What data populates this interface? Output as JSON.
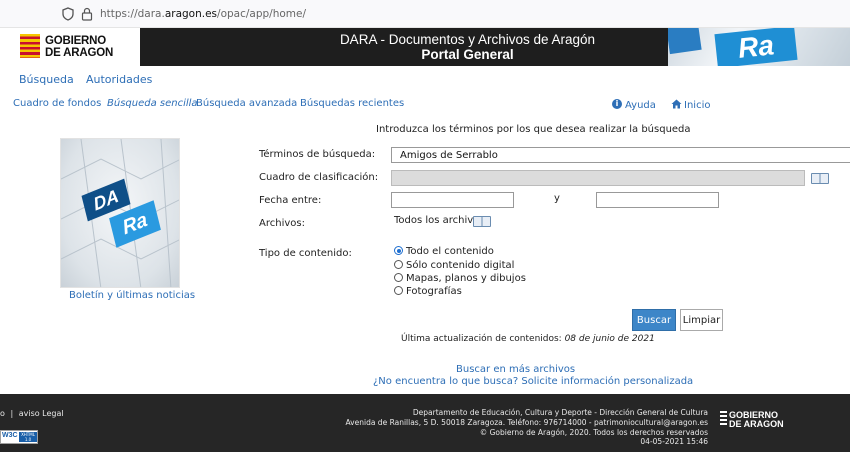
{
  "browser": {
    "url_prefix": "https://dara.",
    "url_domain": "aragon.es",
    "url_path": "/opac/app/home/"
  },
  "banner": {
    "logo_line1": "GOBIERNO",
    "logo_line2": "DE ARAGON",
    "title": "DARA - Documentos y Archivos de Aragón",
    "subtitle": "Portal General",
    "puzzle_text_1": "DA",
    "puzzle_text_2": "Ra"
  },
  "nav": {
    "busqueda": "Búsqueda",
    "autoridades": "Autoridades"
  },
  "subnav": {
    "cuadro": "Cuadro de fondos",
    "sencilla": "Búsqueda sencilla",
    "avanzada": "Búsqueda avanzada",
    "recientes": "Búsquedas recientes",
    "ayuda": "Ayuda",
    "inicio": "Inicio"
  },
  "sidebar": {
    "image_text_1": "DA",
    "image_text_2": "Ra",
    "news_link": "Boletín y últimas noticias"
  },
  "form": {
    "intro": "Introduzca los términos por los que desea realizar la búsqueda",
    "terms_label": "Términos de búsqueda:",
    "terms_value": "Amigos de Serrablo",
    "cuadro_label": "Cuadro de clasificación:",
    "fecha_label": "Fecha entre:",
    "fecha_and": "y",
    "archivos_label": "Archivos:",
    "archivos_value": "Todos los archivos",
    "tipo_label": "Tipo de contenido:",
    "options": [
      "Todo el contenido",
      "Sólo contenido digital",
      "Mapas, planos y dibujos",
      "Fotografías"
    ],
    "buscar": "Buscar",
    "limpiar": "Limpiar",
    "update_prefix": "Última actualización de contenidos: ",
    "update_date": "08 de junio de 2021"
  },
  "links": {
    "mas_archivos": "Buscar en más archivos",
    "solicite": "¿No encuentra lo que busca? Solicite información personalizada"
  },
  "footer": {
    "left_prefix": "o",
    "sep": "|",
    "aviso": "aviso Legal",
    "line1": "Departamento de Educación, Cultura y Deporte - Dirección General de Cultura",
    "line2": "Avenida de Ranillas, 5 D. 50018 Zaragoza. Teléfono: 976714000 - patrimoniocultural@aragon.es",
    "line3": "© Gobierno de Aragón, 2020. Todos los derechos reservados",
    "line4": "04-05-2021 15:46",
    "logo_line1": "GOBIERNO",
    "logo_line2": "DE ARAGON",
    "w3c_text": "W3C",
    "xhtml_text": "XHTML 1.0"
  },
  "colors": {
    "link": "#2d6eb6",
    "primary_button": "#3d86c8",
    "banner_bg": "#1e1e1e",
    "footer_bg": "#262626"
  }
}
